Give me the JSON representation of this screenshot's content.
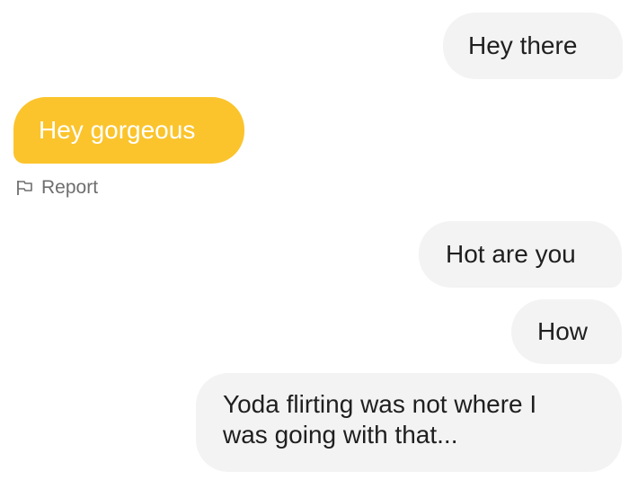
{
  "chat": {
    "messages": [
      {
        "direction": "outgoing",
        "text": "Hey there"
      },
      {
        "direction": "incoming",
        "text": "Hey gorgeous"
      },
      {
        "direction": "outgoing",
        "text": "Hot are you"
      },
      {
        "direction": "outgoing",
        "text": "How"
      },
      {
        "direction": "outgoing",
        "lines": [
          "Yoda flirting was not where I",
          "was going with that..."
        ]
      }
    ],
    "report": {
      "label": "Report",
      "icon": "flag-icon"
    }
  },
  "colors": {
    "incoming_bubble": "#fbc42c",
    "outgoing_bubble": "#f3f3f3",
    "incoming_text": "#ffffff",
    "outgoing_text": "#1f1f1f",
    "report_text": "#6e6e6e"
  }
}
